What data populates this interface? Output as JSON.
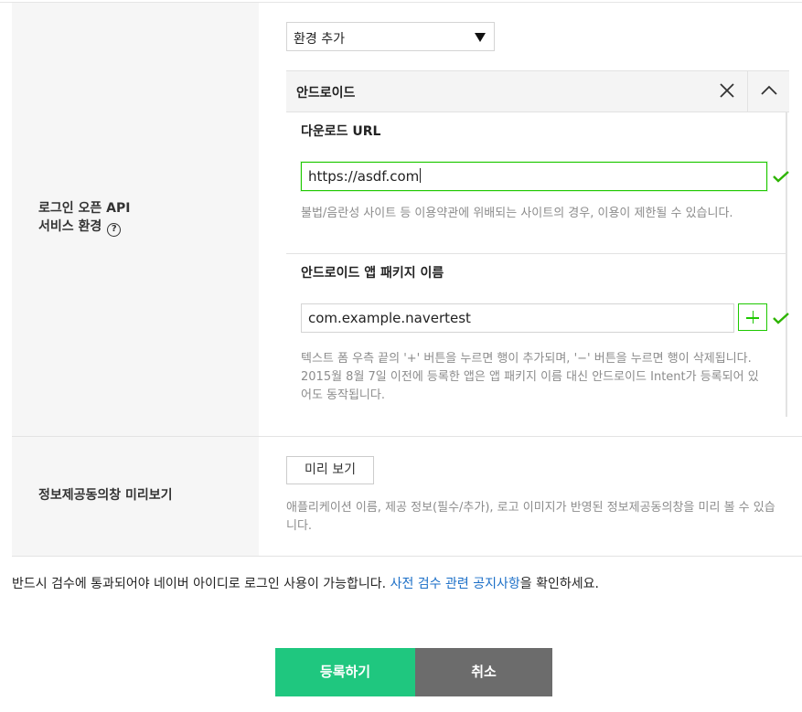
{
  "env_row": {
    "label_line1": "로그인 오픈 API",
    "label_line2": "서비스 환경",
    "help_glyph": "?",
    "select_value": "환경 추가"
  },
  "android_panel": {
    "title": "안드로이드",
    "download_url": {
      "label": "다운로드 URL",
      "value": "https://asdf.com",
      "help": "불법/음란성 사이트 등 이용약관에 위배되는 사이트의 경우, 이용이 제한될 수 있습니다."
    },
    "package": {
      "label": "안드로이드 앱 패키지 이름",
      "value": "com.example.navertest",
      "help_line1": "텍스트 폼 우측 끝의 '+' 버튼을 누르면 행이 추가되며, '−' 버튼을 누르면 행이 삭제됩니다.",
      "help_line2": "2015월 8월 7일 이전에 등록한 앱은 앱 패키지 이름 대신 안드로이드 Intent가 등록되어 있",
      "help_line3": "어도 동작됩니다."
    }
  },
  "consent_row": {
    "label": "정보제공동의창 미리보기",
    "button": "미리 보기",
    "help_line1": "애플리케이션 이름, 제공 정보(필수/추가), 로고 이미지가 반영된 정보제공동의창을 미리 볼 수 있습",
    "help_line2": "니다."
  },
  "notice": {
    "before": "반드시 검수에 통과되어야 네이버 아이디로 로그인 사용이 가능합니다. ",
    "link": "사전 검수 관련 공지사항",
    "after": "을 확인하세요."
  },
  "actions": {
    "submit": "등록하기",
    "cancel": "취소"
  },
  "colors": {
    "accent_green": "#1ec800",
    "submit_bg": "#1fc77f",
    "cancel_bg": "#6c6c6c",
    "link": "#1a6ec7"
  }
}
